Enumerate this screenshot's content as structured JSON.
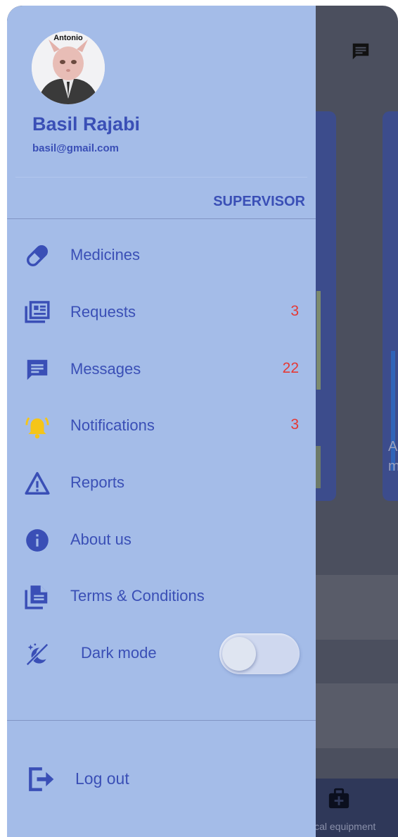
{
  "profile": {
    "avatar_caption": "Antonio",
    "name": "Basil Rajabi",
    "email": "basil@gmail.com",
    "role": "SUPERVISOR"
  },
  "menu": [
    {
      "label": "Medicines",
      "count": "",
      "icon": "pill-icon"
    },
    {
      "label": "Requests",
      "count": "3",
      "icon": "newspaper-icon"
    },
    {
      "label": "Messages",
      "count": "22",
      "icon": "message-icon"
    },
    {
      "label": "Notifications",
      "count": "3",
      "icon": "bell-ringing-icon"
    },
    {
      "label": "Reports",
      "count": "",
      "icon": "warning-triangle-icon"
    },
    {
      "label": "About us",
      "count": "",
      "icon": "info-icon"
    },
    {
      "label": "Terms & Conditions",
      "count": "",
      "icon": "document-icon"
    }
  ],
  "dark_mode": {
    "label": "Dark mode",
    "enabled": false
  },
  "logout": {
    "label": "Log out"
  },
  "background": {
    "nav_label": "ical equipment",
    "card_text_line1": "A",
    "card_text_line2": "m"
  },
  "colors": {
    "drawer_bg": "#a4bce8",
    "accent": "#3a4fb6",
    "badge": "#e53935",
    "bell": "#f5c518"
  }
}
